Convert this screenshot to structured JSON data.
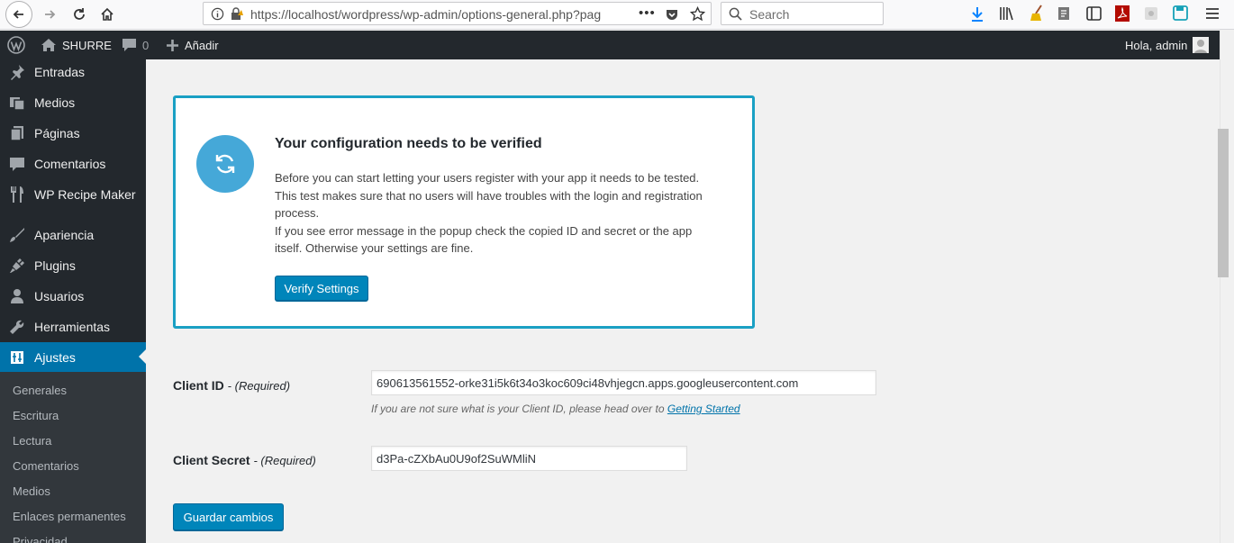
{
  "browser": {
    "url": "https://localhost/wordpress/wp-admin/options-general.php?pag",
    "search_placeholder": "Search"
  },
  "admin_bar": {
    "site_name": "SHURRE",
    "comments_count": "0",
    "add_new_label": "Añadir",
    "greeting": "Hola, admin"
  },
  "sidebar": {
    "items": [
      {
        "label": "Entradas",
        "icon": "pin-icon"
      },
      {
        "label": "Medios",
        "icon": "media-icon"
      },
      {
        "label": "Páginas",
        "icon": "pages-icon"
      },
      {
        "label": "Comentarios",
        "icon": "comment-icon"
      },
      {
        "label": "WP Recipe Maker",
        "icon": "utensils-icon"
      },
      {
        "label": "Apariencia",
        "icon": "brush-icon"
      },
      {
        "label": "Plugins",
        "icon": "plugin-icon"
      },
      {
        "label": "Usuarios",
        "icon": "user-icon"
      },
      {
        "label": "Herramientas",
        "icon": "wrench-icon"
      },
      {
        "label": "Ajustes",
        "icon": "settings-icon"
      }
    ],
    "submenu": [
      "Generales",
      "Escritura",
      "Lectura",
      "Comentarios",
      "Medios",
      "Enlaces permanentes",
      "Privacidad"
    ]
  },
  "notice": {
    "title": "Your configuration needs to be verified",
    "line1": "Before you can start letting your users register with your app it needs to be tested.",
    "line2": "This test makes sure that no users will have troubles with the login and registration",
    "line3": "process.",
    "line4": "If you see error message in the popup check the copied ID and secret or the app",
    "line5": "itself. Otherwise your settings are fine.",
    "button_label": "Verify Settings"
  },
  "form": {
    "client_id_label": "Client ID",
    "client_id_required": "- (Required)",
    "client_id_value": "690613561552-orke31i5k6t34o3koc609ci48vhjegcn.apps.googleusercontent.com",
    "client_id_hint": "If you are not sure what is your Client ID, please head over to",
    "client_id_hint_link": "Getting Started",
    "client_secret_label": "Client Secret",
    "client_secret_required": "- (Required)",
    "client_secret_value": "d3Pa-cZXbAu0U9of2SuWMliN",
    "save_label": "Guardar cambios"
  },
  "colors": {
    "accent": "#0073aa",
    "admin_bar_bg": "#23282d",
    "notice_border": "#1aa0c4",
    "notice_icon_bg": "#45a8d8"
  }
}
